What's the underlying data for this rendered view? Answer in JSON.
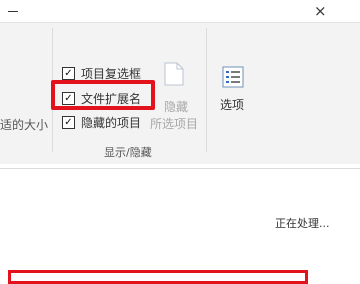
{
  "window": {
    "close_glyph": "×"
  },
  "ribbon": {
    "left_group": {
      "truncated_label": "适的大小"
    },
    "show_hide": {
      "item_checkboxes": {
        "label": "项目复选框",
        "checked": true
      },
      "file_extensions": {
        "label": "文件扩展名",
        "checked": true
      },
      "hidden_items": {
        "label": "隐藏的项目",
        "checked": true
      },
      "hide_selected": {
        "label_top": "隐藏",
        "label_bottom": "所选项目"
      },
      "group_label": "显示/隐藏"
    },
    "options": {
      "label": "选项",
      "icon": "options-list-icon"
    }
  },
  "status_text": "正在处理...",
  "colors": {
    "highlight": "#e3131e",
    "ribbon_bg": "#f3f3f3"
  }
}
